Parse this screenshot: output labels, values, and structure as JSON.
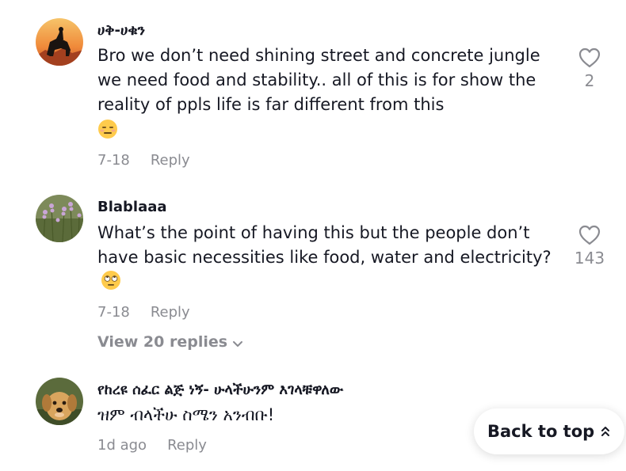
{
  "comments": [
    {
      "username": "ሀቅ-ሀቁን",
      "text": "Bro we don’t need shining street and concrete jungle we need food and stability.. all of this is for show the reality of ppls life is far different from this",
      "emoji": "expressionless-face-emoji",
      "date": "7-18",
      "reply_label": "Reply",
      "like_count": "2"
    },
    {
      "username": "Blablaaa",
      "text": "What’s the point of having this but the people don’t have basic necessities like food, water and electricity?",
      "emoji": "eye-roll-face-emoji",
      "date": "7-18",
      "reply_label": "Reply",
      "like_count": "143",
      "view_replies": "View 20 replies"
    },
    {
      "username": "የከረዩ ሰፈር ልጅ ነኝ- ሁላችሁንም እገላቹዋለው",
      "text": "ዝም ብላችሁ ስሜን አንብቡ!",
      "date": "1d ago",
      "reply_label": "Reply"
    }
  ],
  "back_to_top": {
    "label": "Back to top",
    "icon": "double-chevron-up-icon"
  },
  "colors": {
    "primary_text": "#161823",
    "secondary_text": "#8a8b91",
    "background": "#ffffff"
  }
}
